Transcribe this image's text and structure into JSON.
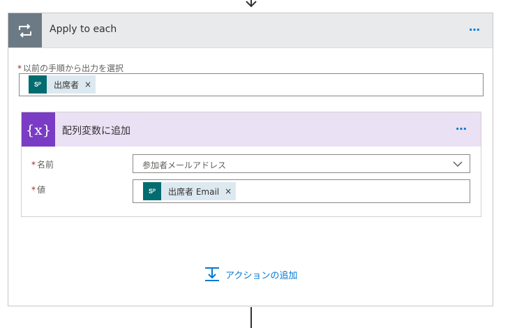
{
  "loop": {
    "title": "Apply to each",
    "more_label": "⋯",
    "select_label": "以前の手順から出力を選択",
    "token_label": "出席者",
    "token_close": "×",
    "token_icon": "sharepoint-icon"
  },
  "action": {
    "title": "配列変数に追加",
    "more_label": "⋯",
    "icon_text": "{x}",
    "name_label": "名前",
    "name_value": "参加者メールアドレス",
    "value_label": "値",
    "value_token": "出席者 Email",
    "value_token_close": "×"
  },
  "add_action": {
    "label": "アクションの追加"
  },
  "required_mark": "*",
  "colors": {
    "accent": "#0078d4",
    "loop_icon_bg": "#6c7a85",
    "variable_icon_bg": "#7a3cc4",
    "variable_header_bg": "#ebe1f5",
    "sharepoint": "#036c70",
    "token_bg": "#dde9f0"
  }
}
